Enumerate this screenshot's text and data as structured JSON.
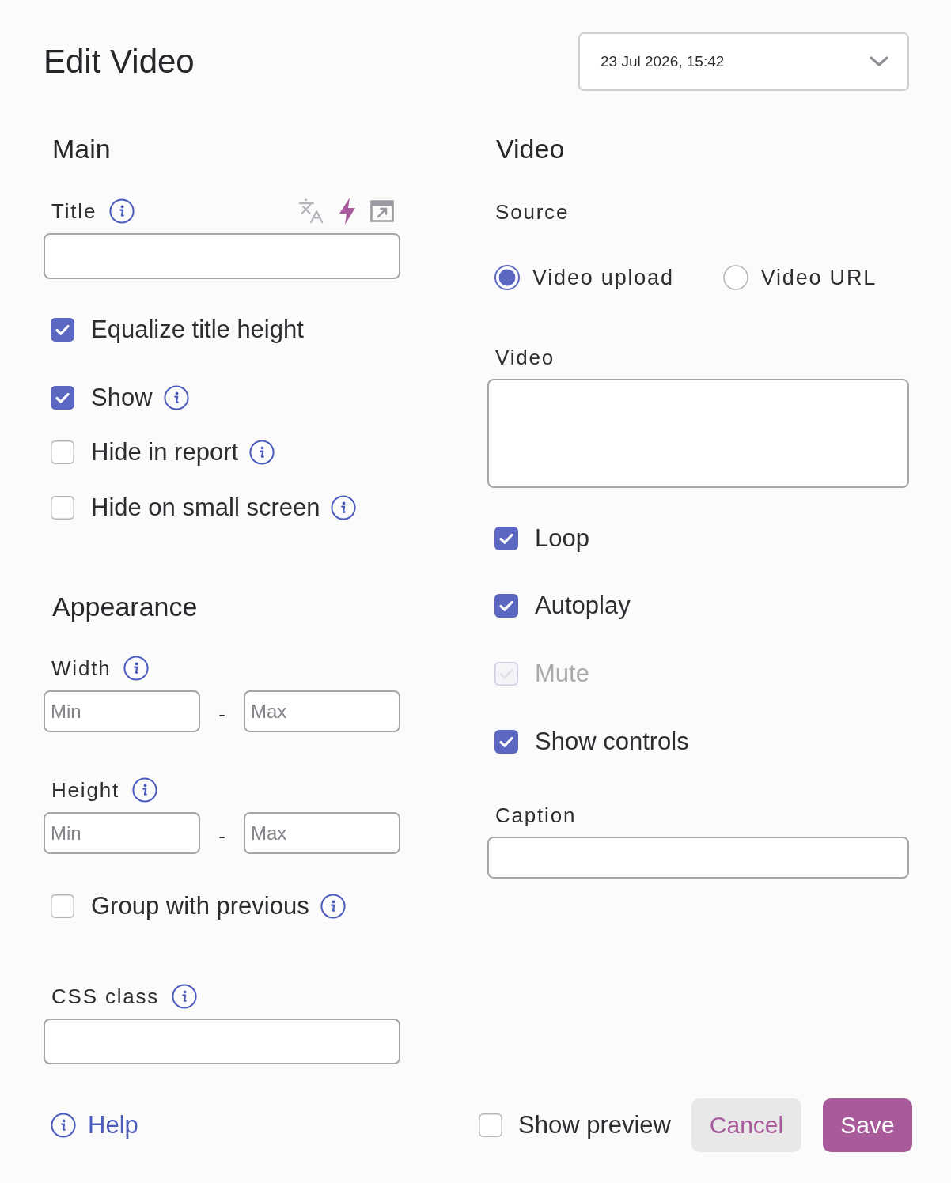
{
  "header": {
    "title": "Edit Video",
    "version_select": {
      "value": "23 Jul 2026, 15:42"
    }
  },
  "main": {
    "heading": "Main",
    "title_field": {
      "label": "Title",
      "info": true
    },
    "checkboxes": [
      {
        "label": "Equalize title height",
        "checked": true
      },
      {
        "label": "Show",
        "checked": true,
        "info": true
      },
      {
        "label": "Hide in report",
        "checked": false,
        "info": true
      },
      {
        "label": "Hide on small screen",
        "checked": false,
        "info": true
      }
    ]
  },
  "appearance": {
    "heading": "Appearance",
    "width": {
      "label": "Width",
      "info": true,
      "inputs": [
        {
          "placeholder": "Min"
        },
        {
          "placeholder": "Max"
        }
      ],
      "separator": "-"
    },
    "height": {
      "label": "Height",
      "info": true,
      "inputs": [
        {
          "placeholder": "Min"
        },
        {
          "placeholder": "Max"
        }
      ],
      "separator": "-"
    },
    "group_with_previous": {
      "label": "Group with previous",
      "checked": false,
      "info": true
    },
    "css_class": {
      "label": "CSS class",
      "info": true
    }
  },
  "video": {
    "heading": "Video",
    "source": {
      "label": "Source",
      "options": [
        {
          "label": "Video upload",
          "selected": true
        },
        {
          "label": "Video URL",
          "selected": false
        }
      ]
    },
    "video_field": {
      "label": "Video"
    },
    "options": [
      {
        "label": "Loop",
        "checked": true,
        "disabled": false
      },
      {
        "label": "Autoplay",
        "checked": true,
        "disabled": false
      },
      {
        "label": "Mute",
        "checked": true,
        "disabled": true
      },
      {
        "label": "Show controls",
        "checked": true,
        "disabled": false
      }
    ],
    "caption": {
      "label": "Caption"
    }
  },
  "footer": {
    "help": "Help",
    "show_preview": {
      "label": "Show preview",
      "checked": false
    },
    "buttons": [
      {
        "label": "Cancel",
        "kind": "secondary"
      },
      {
        "label": "Save",
        "kind": "primary"
      }
    ]
  }
}
